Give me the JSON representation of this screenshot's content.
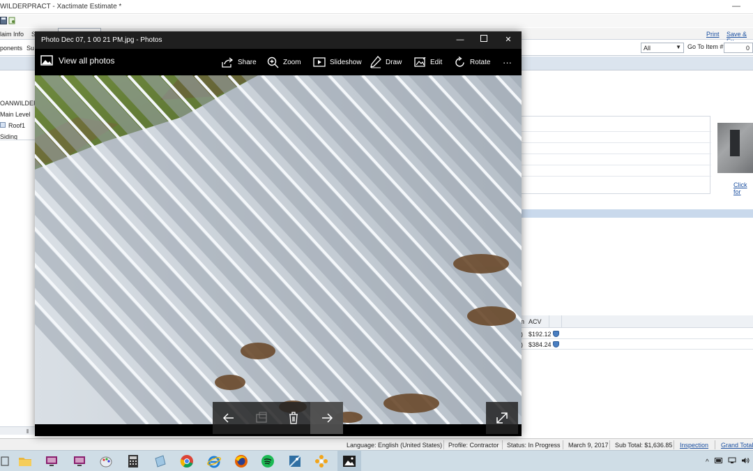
{
  "app": {
    "title": "WILDERPRACT - Xactimate Estimate *",
    "minimize_glyph": "—"
  },
  "menubar": {
    "claim_info": "laim Info",
    "s_item": "S",
    "print": "Print",
    "save_exit": "Save & Ex"
  },
  "toolbar": {
    "components": "ponents",
    "sup": "Su",
    "filter_value": "All",
    "goto_label": "Go To Item #:",
    "goto_value": "0"
  },
  "tree": {
    "project": "OANWILDER",
    "level": "Main Level",
    "room": "Roof1",
    "siding": "Siding"
  },
  "right_panel": {
    "click_link": "Click for",
    "table_headers": [
      "n",
      "ACV"
    ],
    "rows": [
      {
        "paren": ")",
        "acv": "$192.12"
      },
      {
        "paren": ")",
        "acv": "$384.24"
      }
    ]
  },
  "photos": {
    "title": "Photo Dec 07, 1 00 21 PM.jpg - Photos",
    "view_all": "View all photos",
    "commands": {
      "share": "Share",
      "zoom": "Zoom",
      "slideshow": "Slideshow",
      "draw": "Draw",
      "edit": "Edit",
      "rotate": "Rotate",
      "more": "···"
    }
  },
  "statusbar": {
    "language": "Language:  English (United States)",
    "profile": "Profile:  Contractor",
    "status": "Status:  In Progress",
    "date": "March 9, 2017",
    "subtotal": "Sub Total: $1,636.85",
    "inspection": "Inspection",
    "grand_total": "Grand Total"
  },
  "taskbar": {
    "tray_chevron": "^"
  },
  "colors": {
    "accent_blue": "#1a4fa0",
    "photo_titlebar": "#1f1f1f",
    "taskbar": "#cfdde6"
  }
}
